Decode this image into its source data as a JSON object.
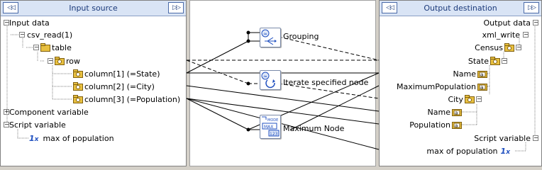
{
  "input_pane": {
    "title": "Input source",
    "left_button": "◁◁",
    "right_button": "▷▷",
    "items": [
      {
        "label": "Input data"
      },
      {
        "label": "csv_read(1)"
      },
      {
        "label": "table"
      },
      {
        "label": "row"
      },
      {
        "label": "column[1] (=State)"
      },
      {
        "label": "column[2] (=City)"
      },
      {
        "label": "column[3] (=Population)"
      },
      {
        "label": "Component variable"
      },
      {
        "label": "Script variable"
      },
      {
        "label": "max of population"
      }
    ]
  },
  "output_pane": {
    "title": "Output destination",
    "left_button": "◁◁",
    "right_button": "▷▷",
    "items": [
      {
        "label": "Output data"
      },
      {
        "label": "xml_write"
      },
      {
        "label": "Census"
      },
      {
        "label": "State"
      },
      {
        "label": "Name"
      },
      {
        "label": "MaximumPopulation"
      },
      {
        "label": "City"
      },
      {
        "label": "Name"
      },
      {
        "label": "Population"
      },
      {
        "label": "Script variable"
      },
      {
        "label": "max of population"
      }
    ]
  },
  "mapping_nodes": [
    {
      "label": "Grouping",
      "icon": "grouping-icon"
    },
    {
      "label": "Iterate specified node",
      "icon": "iterate-icon"
    },
    {
      "label": "Maximum Node",
      "icon": "max-node-icon",
      "icon_text_top": "MODE",
      "icon_text_mid": "MAX",
      "icon_text_bot": "123"
    }
  ],
  "colors": {
    "header_bg": "#d9e4f5",
    "header_text": "#1b3a7a",
    "folder": "#e8c040",
    "var_blue": "#2050c0"
  }
}
